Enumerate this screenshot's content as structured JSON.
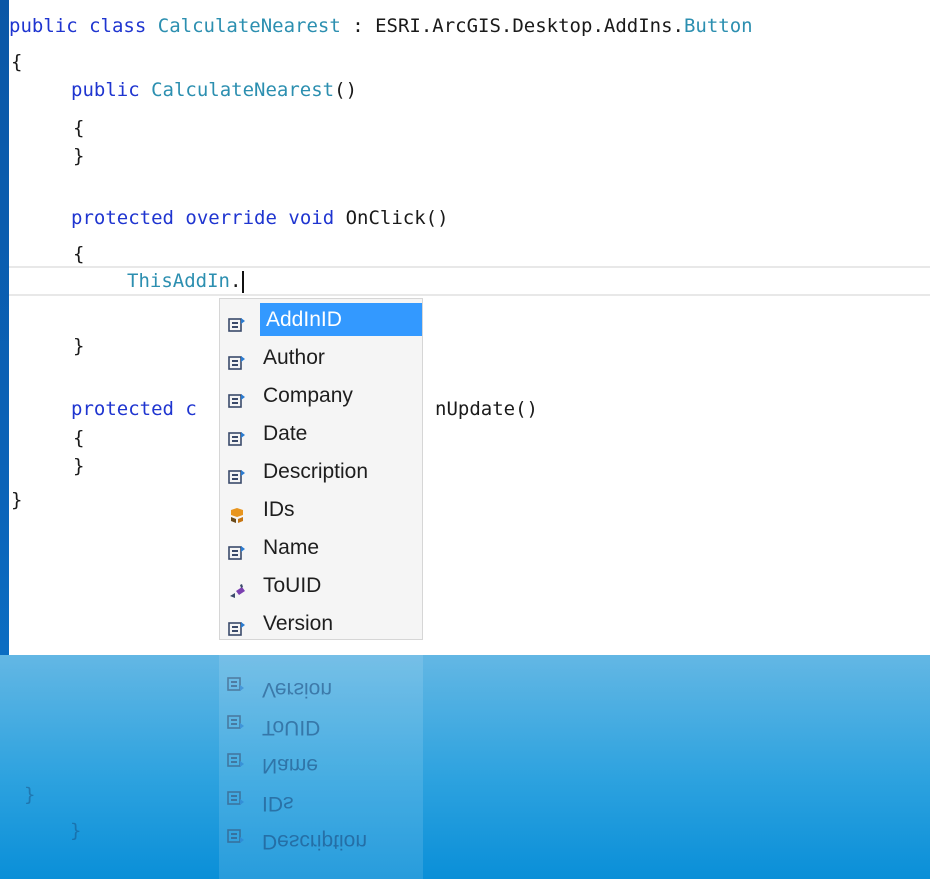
{
  "code": {
    "line1": {
      "kw1": "public",
      "kw2": "class",
      "type": "CalculateNearest",
      "rest": " : ESRI.ArcGIS.Desktop.AddIns.",
      "base": "Button"
    },
    "line2": "{",
    "line3": {
      "kw": "public",
      "type": "CalculateNearest",
      "rest": "()"
    },
    "line4": "{",
    "line5": "}",
    "line6": {
      "kw1": "protected",
      "kw2": "override",
      "kw3": "void",
      "rest": "OnClick()"
    },
    "line7": "{",
    "line8": {
      "type": "ThisAddIn",
      "rest": "."
    },
    "line9": "}",
    "line10": {
      "kw": "protected",
      "partial": "c",
      "rest": "nUpdate()"
    },
    "line11": "{",
    "line12": "}",
    "line13": "}"
  },
  "intellisense": {
    "selected_index": 0,
    "items": [
      {
        "label": "AddInID",
        "icon": "property-icon"
      },
      {
        "label": "Author",
        "icon": "property-icon"
      },
      {
        "label": "Company",
        "icon": "property-icon"
      },
      {
        "label": "Date",
        "icon": "property-icon"
      },
      {
        "label": "Description",
        "icon": "property-icon"
      },
      {
        "label": "IDs",
        "icon": "class-icon"
      },
      {
        "label": "Name",
        "icon": "property-icon"
      },
      {
        "label": "ToUID",
        "icon": "method-icon"
      },
      {
        "label": "Version",
        "icon": "property-icon"
      }
    ]
  },
  "reflection": {
    "items": [
      "Version",
      "ToUID",
      "Name",
      "IDs",
      "Description"
    ]
  },
  "colors": {
    "keyword": "#1f35d0",
    "type": "#2c8fb0",
    "selection": "#3399ff"
  }
}
